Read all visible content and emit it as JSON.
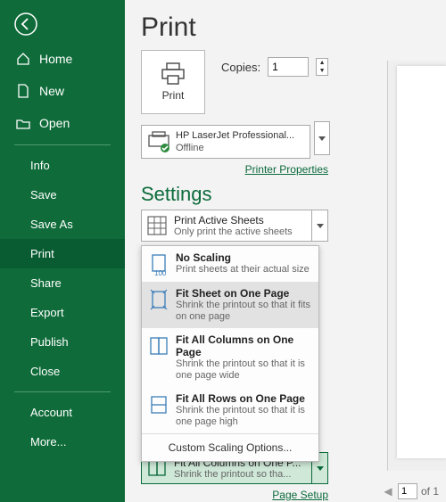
{
  "page_title": "Print",
  "back_icon": "back-arrow",
  "sidebar": {
    "main": [
      {
        "icon": "home",
        "label": "Home"
      },
      {
        "icon": "new",
        "label": "New"
      },
      {
        "icon": "open",
        "label": "Open"
      }
    ],
    "file": [
      {
        "label": "Info"
      },
      {
        "label": "Save"
      },
      {
        "label": "Save As"
      },
      {
        "label": "Print",
        "selected": true
      },
      {
        "label": "Share"
      },
      {
        "label": "Export"
      },
      {
        "label": "Publish"
      },
      {
        "label": "Close"
      }
    ],
    "bottom": [
      {
        "label": "Account"
      },
      {
        "label": "More..."
      }
    ]
  },
  "print_button_label": "Print",
  "copies": {
    "label": "Copies:",
    "value": "1"
  },
  "printer": {
    "name": "HP LaserJet Professional...",
    "status": "Offline",
    "properties_link": "Printer Properties"
  },
  "settings_heading": "Settings",
  "active_sheets": {
    "title": "Print Active Sheets",
    "subtitle": "Only print the active sheets"
  },
  "scaling_options": [
    {
      "title": "No Scaling",
      "desc": "Print sheets at their actual size",
      "icon": "100"
    },
    {
      "title": "Fit Sheet on One Page",
      "desc": "Shrink the printout so that it fits on one page",
      "icon": "fit-sheet",
      "hover": true
    },
    {
      "title": "Fit All Columns on One Page",
      "desc": "Shrink the printout so that it is one page wide",
      "icon": "fit-cols"
    },
    {
      "title": "Fit All Rows on One Page",
      "desc": "Shrink the printout so that it is one page high",
      "icon": "fit-rows"
    }
  ],
  "custom_scaling_label": "Custom Scaling Options...",
  "current_scaling": {
    "title": "Fit All Columns on One P...",
    "subtitle": "Shrink the printout so tha..."
  },
  "page_setup_link": "Page Setup",
  "pager": {
    "current": "1",
    "total": "of 1"
  }
}
